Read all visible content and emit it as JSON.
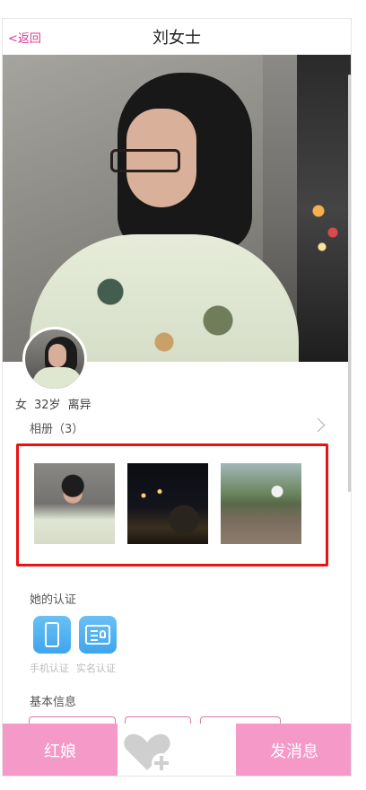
{
  "header": {
    "back_label": "<返回",
    "title": "刘女士"
  },
  "profile": {
    "gender": "女",
    "age": "32岁",
    "marital_status": "离异"
  },
  "album": {
    "label": "相册（3）",
    "photo_count": 3
  },
  "certification": {
    "label": "她的认证",
    "items": [
      {
        "label": "手机认证",
        "icon": "phone-icon"
      },
      {
        "label": "实名认证",
        "icon": "id-card-icon"
      }
    ]
  },
  "basic_info": {
    "label": "基本信息"
  },
  "bottom_bar": {
    "left_button": "红娘",
    "right_button": "发消息",
    "center_icon": "heart-plus-icon"
  },
  "colors": {
    "accent": "#f59ac8",
    "back_link": "#d63b8f",
    "highlight_border": "#ee1111",
    "cert_blue": "#3ea5ee"
  }
}
